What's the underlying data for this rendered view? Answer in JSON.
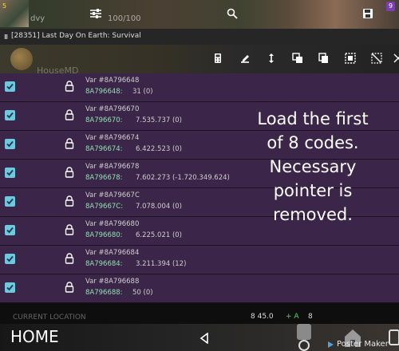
{
  "topbar": {
    "badge": "5",
    "game_text": "dvy",
    "hp": "100/100",
    "notif_count": "9"
  },
  "process": {
    "icon": "III",
    "name": "[28351] Last Day On Earth: Survival"
  },
  "toolbar": {
    "ghost_label": "HouseMD"
  },
  "rows": [
    {
      "name": "Var #8A796648",
      "addr": "8A796648:",
      "value": "31 (0)"
    },
    {
      "name": "Var #8A796670",
      "addr": "8A796670:",
      "value": "7.535.737 (0)"
    },
    {
      "name": "Var #8A796674",
      "addr": "8A796674:",
      "value": "6.422.523 (0)"
    },
    {
      "name": "Var #8A796678",
      "addr": "8A796678:",
      "value": "7.602.273 (-1.720.349.624)"
    },
    {
      "name": "Var #8A79667C",
      "addr": "8A79667C:",
      "value": "7.078.004 (0)"
    },
    {
      "name": "Var #8A796680",
      "addr": "8A796680:",
      "value": "6.225.021 (0)"
    },
    {
      "name": "Var #8A796684",
      "addr": "8A796684:",
      "value": "3.211.394 (12)"
    },
    {
      "name": "Var #8A796688",
      "addr": "8A796688:",
      "value": "50 (0)"
    }
  ],
  "caption": {
    "line1": "Load the first",
    "line2": "of 8 codes.",
    "line3": "Necessary",
    "line4": "pointer is",
    "line5": "removed."
  },
  "location": {
    "label": "CURRENT LOCATION",
    "speed": "8 45.0",
    "a": "+ A",
    "num": "8"
  },
  "nav": {
    "home": "HOME",
    "poster": "Poster Maker"
  },
  "colors": {
    "list_bg": "#3b2548",
    "checkbox": "#6fc7e0",
    "address": "#8fe0b0"
  }
}
